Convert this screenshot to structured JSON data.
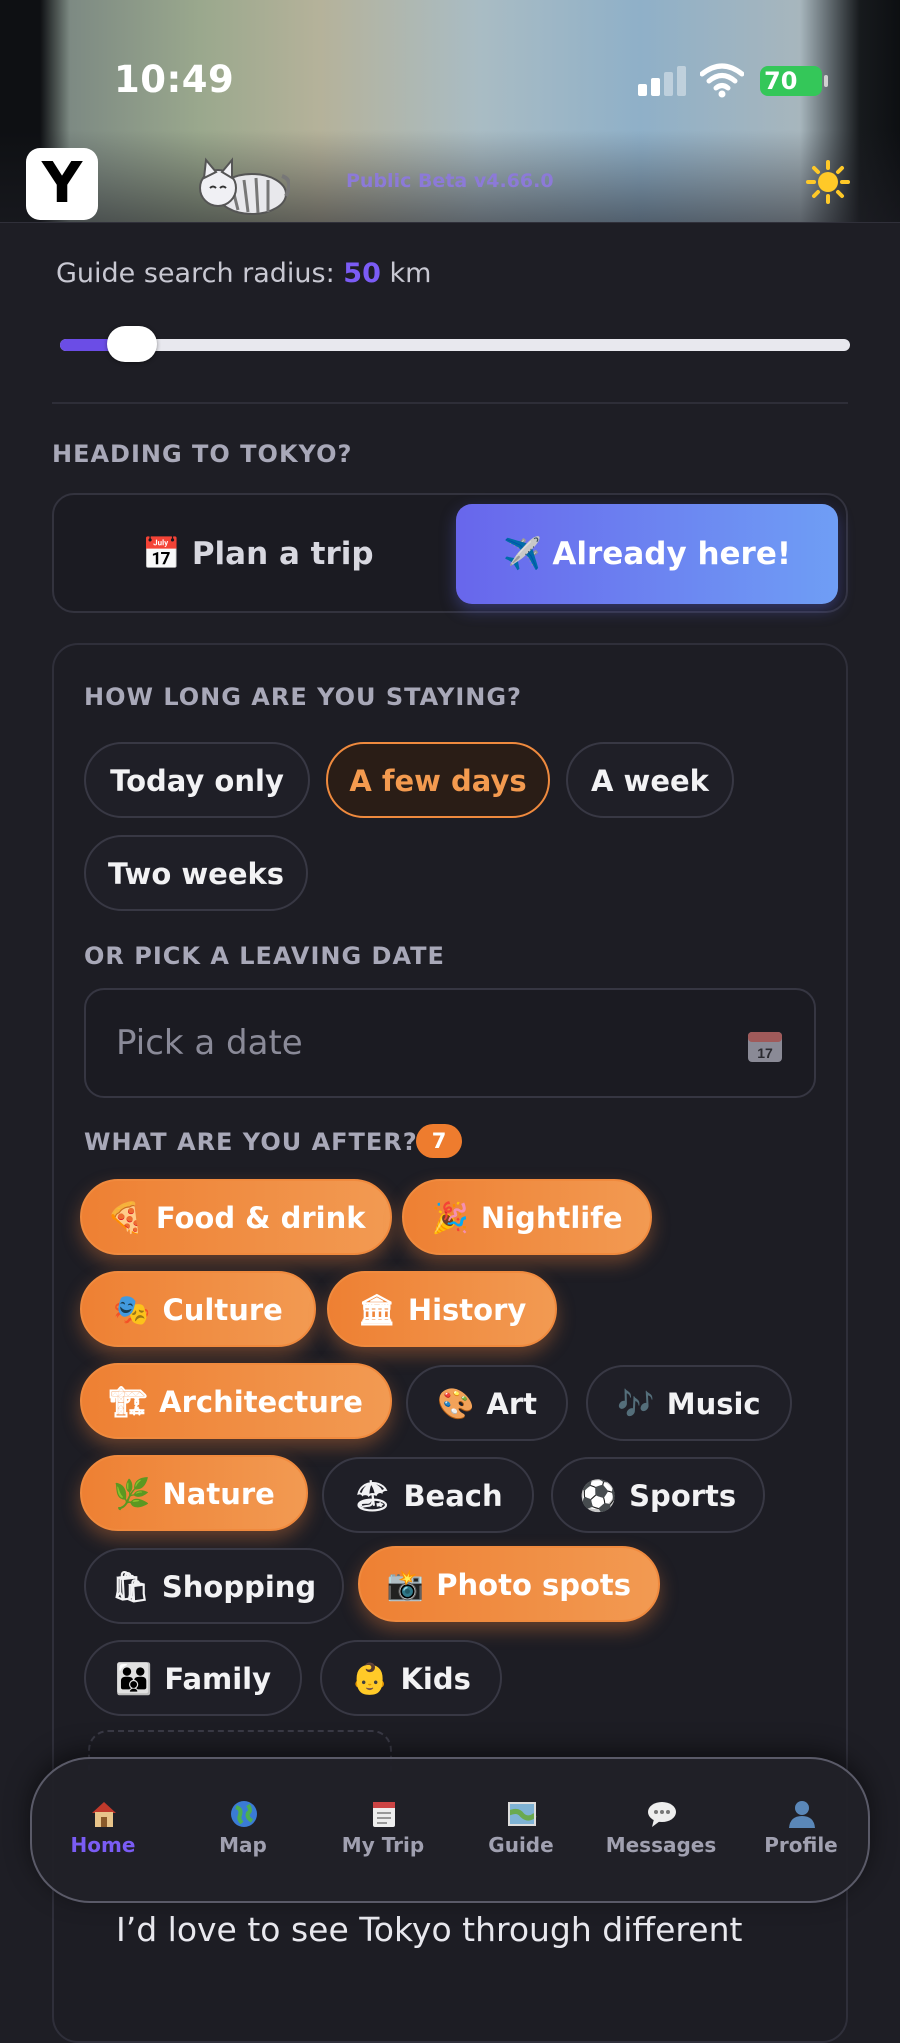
{
  "status_bar": {
    "time": "10:49",
    "battery": "70"
  },
  "header": {
    "logo_letter": "Y",
    "beta_label": "Public Beta v4.66.0"
  },
  "radius": {
    "prefix": "Guide search radius: ",
    "value": "50",
    "unit": " km",
    "slider_fraction": 0.06
  },
  "heading": {
    "title": "HEADING TO TOKYO?",
    "plan_label": "Plan a trip",
    "here_label": "Already here!",
    "plan_icon": "calendar-icon",
    "here_icon": "airplane-icon",
    "selected": "Already here!"
  },
  "stay": {
    "title": "HOW LONG ARE YOU STAYING?",
    "options": [
      "Today only",
      "A few days",
      "A week",
      "Two weeks"
    ],
    "selected": "A few days"
  },
  "leaving": {
    "title": "OR PICK A LEAVING DATE",
    "placeholder": "Pick a date"
  },
  "interests": {
    "title": "WHAT ARE YOU AFTER?",
    "count": "7",
    "items": [
      {
        "label": "Food & drink",
        "emoji": "🍕",
        "selected": true
      },
      {
        "label": "Nightlife",
        "emoji": "🎉",
        "selected": true
      },
      {
        "label": "Culture",
        "emoji": "🎭",
        "selected": true
      },
      {
        "label": "History",
        "emoji": "🏛",
        "selected": true
      },
      {
        "label": "Architecture",
        "emoji": "🏗",
        "selected": true
      },
      {
        "label": "Art",
        "emoji": "🎨",
        "selected": false
      },
      {
        "label": "Music",
        "emoji": "🎶",
        "selected": false
      },
      {
        "label": "Nature",
        "emoji": "🌿",
        "selected": true
      },
      {
        "label": "Beach",
        "emoji": "🏖",
        "selected": false
      },
      {
        "label": "Sports",
        "emoji": "⚽",
        "selected": false
      },
      {
        "label": "Shopping",
        "emoji": "🛍",
        "selected": false
      },
      {
        "label": "Photo spots",
        "emoji": "📸",
        "selected": true
      },
      {
        "label": "Family",
        "emoji": "👪",
        "selected": false
      },
      {
        "label": "Kids",
        "emoji": "👶",
        "selected": false
      }
    ]
  },
  "prompt_text": "I’d love to see Tokyo through different",
  "tabs": [
    {
      "label": "Home",
      "icon": "house-icon",
      "active": true
    },
    {
      "label": "Map",
      "icon": "globe-icon",
      "active": false
    },
    {
      "label": "My Trip",
      "icon": "notepad-icon",
      "active": false
    },
    {
      "label": "Guide",
      "icon": "map-icon",
      "active": false
    },
    {
      "label": "Messages",
      "icon": "speech-bubble-icon",
      "active": false
    },
    {
      "label": "Profile",
      "icon": "person-icon",
      "active": false
    }
  ],
  "colors": {
    "accent_purple": "#7b5cf5",
    "accent_orange": "#ee8033",
    "background": "#1e1e25"
  }
}
